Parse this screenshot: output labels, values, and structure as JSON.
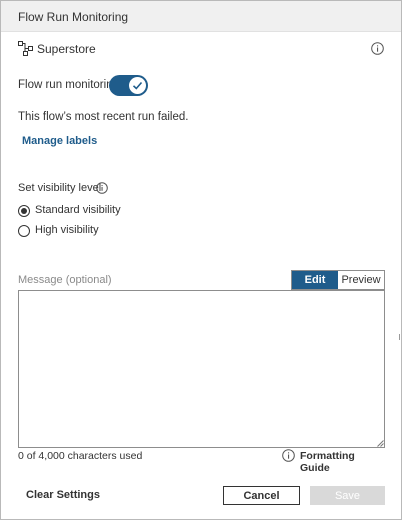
{
  "dialog": {
    "title": "Flow Run Monitoring"
  },
  "flow": {
    "name": "Superstore",
    "icon": "flow-icon"
  },
  "monitoring": {
    "label": "Flow run monitoring",
    "enabled": true
  },
  "status_text": "This flow’s most recent run failed.",
  "manage_labels": "Manage labels",
  "visibility": {
    "label": "Set visibility level",
    "options": [
      {
        "label": "Standard visibility",
        "selected": true
      },
      {
        "label": "High visibility",
        "selected": false
      }
    ]
  },
  "message": {
    "label": "Message (optional)",
    "tabs": [
      "Edit",
      "Preview"
    ],
    "active_tab": "Edit",
    "value": "",
    "char_count": "0 of 4,000 characters used",
    "formatting_guide": "Formatting Guide"
  },
  "footer": {
    "clear_label": "Clear Settings",
    "cancel_label": "Cancel",
    "save_label": "Save"
  },
  "colors": {
    "accent": "#1f5c8b",
    "disabled": "#d9d9d9"
  }
}
